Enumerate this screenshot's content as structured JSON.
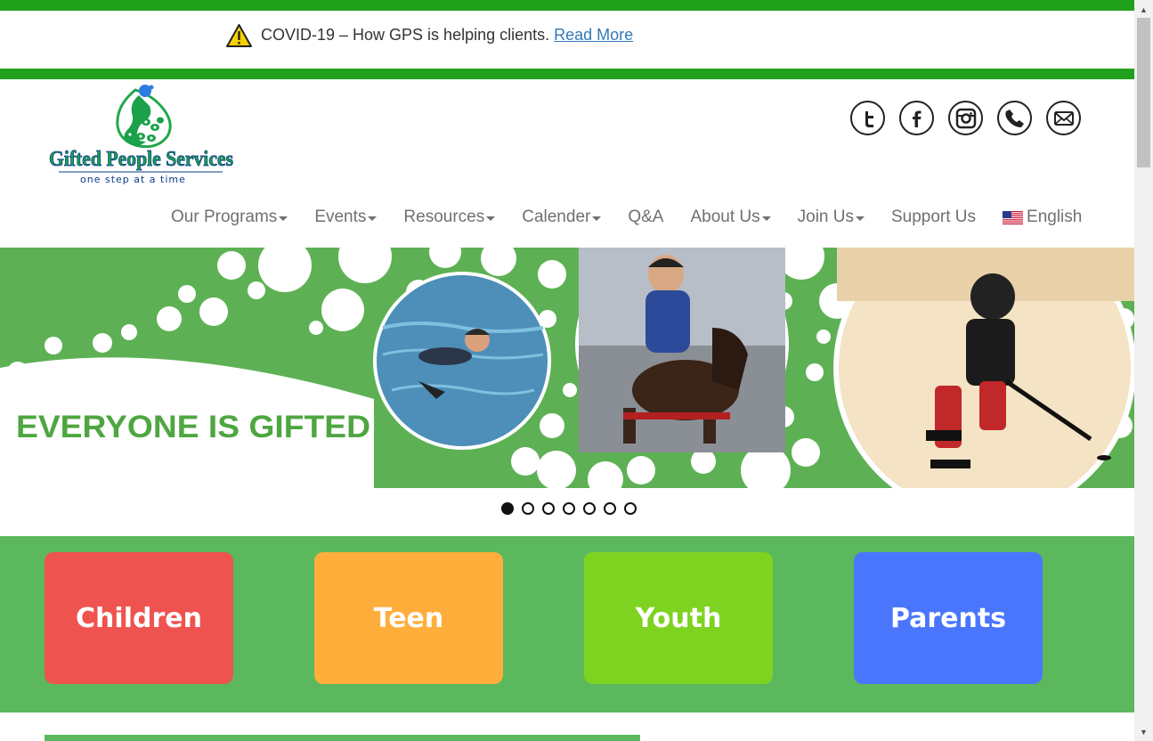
{
  "alert": {
    "text": "COVID-19 – How GPS is helping clients.",
    "link_label": "Read More"
  },
  "logo": {
    "name": "Gifted People Services",
    "tagline": "one step at a time"
  },
  "social": {
    "icons": [
      "twitter-icon",
      "facebook-icon",
      "instagram-icon",
      "phone-icon",
      "mail-icon"
    ]
  },
  "nav": {
    "items": [
      {
        "label": "Our Programs",
        "dropdown": true
      },
      {
        "label": "Events",
        "dropdown": true
      },
      {
        "label": "Resources",
        "dropdown": true
      },
      {
        "label": "Calender",
        "dropdown": true
      },
      {
        "label": "Q&A",
        "dropdown": false
      },
      {
        "label": "About Us",
        "dropdown": true
      },
      {
        "label": "Join Us",
        "dropdown": true
      },
      {
        "label": "Support Us",
        "dropdown": false
      }
    ],
    "language": "English"
  },
  "hero": {
    "title": "EVERYONE IS GIFTED",
    "slide_count": 7,
    "active_slide": 1
  },
  "categories": [
    {
      "label": "Children",
      "color": "#ef5350"
    },
    {
      "label": "Teen",
      "color": "#ffae3b"
    },
    {
      "label": "Youth",
      "color": "#7ed321"
    },
    {
      "label": "Parents",
      "color": "#4a76fd"
    }
  ],
  "colors": {
    "brand_green": "#21a01b",
    "section_green": "#5cb85c"
  }
}
